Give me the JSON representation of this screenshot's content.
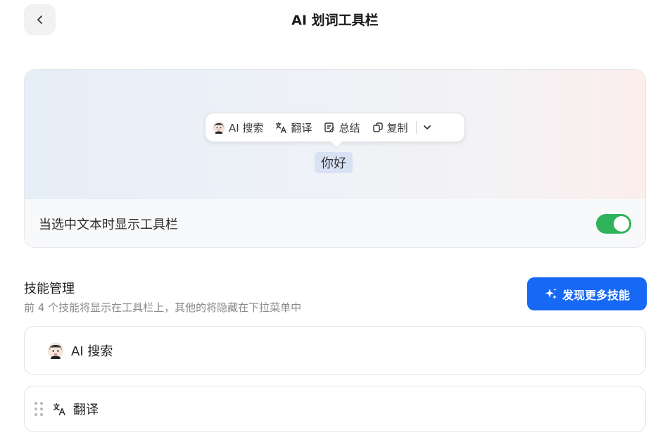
{
  "header": {
    "title": "AI 划词工具栏"
  },
  "preview": {
    "toolbar": {
      "items": [
        {
          "label": "AI 搜索",
          "icon": "ai-avatar-icon"
        },
        {
          "label": "翻译",
          "icon": "translate-icon"
        },
        {
          "label": "总结",
          "icon": "summary-icon"
        },
        {
          "label": "复制",
          "icon": "copy-icon"
        }
      ],
      "more_icon": "chevron-down-icon"
    },
    "selected_text": "你好"
  },
  "setting": {
    "label": "当选中文本时显示工具栏",
    "toggle_on": true,
    "toggle_color": "#2fb35a"
  },
  "skills": {
    "title": "技能管理",
    "description": "前 4 个技能将显示在工具栏上，其他的将隐藏在下拉菜单中",
    "discover_label": "发现更多技能",
    "discover_color": "#1668f5",
    "items": [
      {
        "label": "AI 搜索",
        "icon": "ai-avatar-icon"
      },
      {
        "label": "翻译",
        "icon": "translate-icon"
      }
    ]
  }
}
